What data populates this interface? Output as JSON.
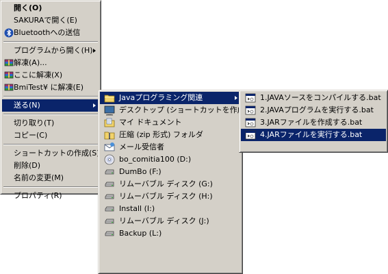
{
  "main_menu": {
    "items": [
      {
        "label": "開く(O)",
        "bold": true,
        "icon": "none"
      },
      {
        "label": "SAKURAで開く(E)",
        "icon": "none"
      },
      {
        "label": "Bluetoothへの送信",
        "icon": "bluetooth-icon"
      },
      {
        "sep": true
      },
      {
        "label": "プログラムから開く(H)",
        "icon": "none",
        "submenu": true
      },
      {
        "label": "解凍(A)...",
        "icon": "archive-icon"
      },
      {
        "label": "ここに解凍(X)",
        "icon": "archive-icon"
      },
      {
        "label": "BmiTest¥ に解凍(E)",
        "icon": "archive-icon"
      },
      {
        "sep": true
      },
      {
        "label": "送る(N)",
        "icon": "none",
        "submenu": true,
        "highlight": true
      },
      {
        "sep": true
      },
      {
        "label": "切り取り(T)",
        "icon": "none"
      },
      {
        "label": "コピー(C)",
        "icon": "none"
      },
      {
        "sep": true
      },
      {
        "label": "ショートカットの作成(S)",
        "icon": "none"
      },
      {
        "label": "削除(D)",
        "icon": "none"
      },
      {
        "label": "名前の変更(M)",
        "icon": "none"
      },
      {
        "sep": true
      },
      {
        "label": "プロパティ(R)",
        "icon": "none"
      }
    ]
  },
  "sendto_menu": {
    "items": [
      {
        "label": "Javaプログラミング関連",
        "icon": "folder-icon",
        "submenu": true,
        "highlight": true
      },
      {
        "label": "デスクトップ (ショートカットを作成)",
        "icon": "desktop-icon"
      },
      {
        "label": "マイ ドキュメント",
        "icon": "my-documents-icon"
      },
      {
        "label": "圧縮 (zip 形式) フォルダ",
        "icon": "zip-folder-icon"
      },
      {
        "label": "メール受信者",
        "icon": "mail-recipient-icon"
      },
      {
        "label": "bo_comitia100 (D:)",
        "icon": "cd-drive-icon"
      },
      {
        "label": "DumBo (F:)",
        "icon": "drive-icon"
      },
      {
        "label": "リムーバブル ディスク (G:)",
        "icon": "drive-icon"
      },
      {
        "label": "リムーバブル ディスク (H:)",
        "icon": "drive-icon"
      },
      {
        "label": "Install (I:)",
        "icon": "drive-icon"
      },
      {
        "label": "リムーバブル ディスク (J:)",
        "icon": "drive-icon"
      },
      {
        "label": "Backup (L:)",
        "icon": "drive-icon"
      }
    ]
  },
  "java_menu": {
    "items": [
      {
        "label": "1.JAVAソースをコンパイルする.bat",
        "icon": "bat-file-icon"
      },
      {
        "label": "2.JAVAプログラムを実行する.bat",
        "icon": "bat-file-icon"
      },
      {
        "label": "3.JARファイルを作成する.bat",
        "icon": "bat-file-icon"
      },
      {
        "label": "4.JARファイルを実行する.bat",
        "icon": "bat-file-icon",
        "highlight": true
      }
    ]
  }
}
